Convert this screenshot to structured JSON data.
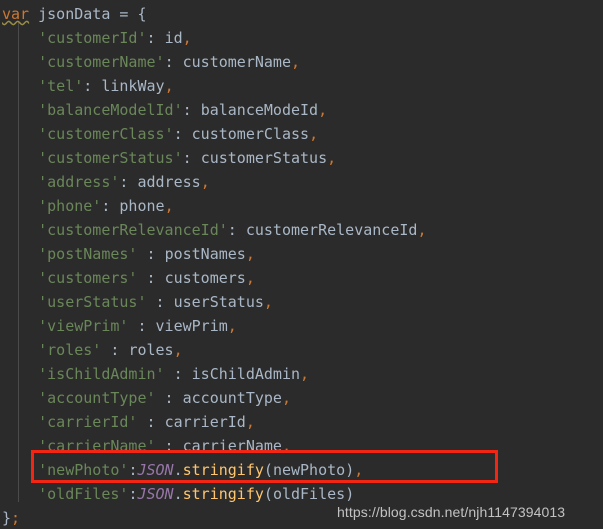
{
  "editor": {
    "background_color": "#2b2b2b",
    "default_text_color": "#a9b7c6",
    "annotation_color": "#f22613"
  },
  "code": {
    "line1": {
      "keyword": "var",
      "name": "jsonData",
      "equals": "=",
      "brace": "{"
    },
    "properties": [
      {
        "key": "'customerId'",
        "sep": ": ",
        "value": "id",
        "comma": ","
      },
      {
        "key": "'customerName'",
        "sep": ": ",
        "value": "customerName",
        "comma": ","
      },
      {
        "key": "'tel'",
        "sep": ": ",
        "value": "linkWay",
        "comma": ","
      },
      {
        "key": "'balanceModelId'",
        "sep": ": ",
        "value": "balanceModeId",
        "comma": ","
      },
      {
        "key": "'customerClass'",
        "sep": ": ",
        "value": "customerClass",
        "comma": ","
      },
      {
        "key": "'customerStatus'",
        "sep": ": ",
        "value": "customerStatus",
        "comma": ","
      },
      {
        "key": "'address'",
        "sep": ": ",
        "value": "address",
        "comma": ","
      },
      {
        "key": "'phone'",
        "sep": ": ",
        "value": "phone",
        "comma": ","
      },
      {
        "key": "'customerRelevanceId'",
        "sep": ": ",
        "value": "customerRelevanceId",
        "comma": ","
      },
      {
        "key": "'postNames'",
        "sep": " : ",
        "value": "postNames",
        "comma": ","
      },
      {
        "key": "'customers'",
        "sep": " : ",
        "value": "customers",
        "comma": ","
      },
      {
        "key": "'userStatus'",
        "sep": " : ",
        "value": "userStatus",
        "comma": ","
      },
      {
        "key": "'viewPrim'",
        "sep": " : ",
        "value": "viewPrim",
        "comma": ","
      },
      {
        "key": "'roles'",
        "sep": " : ",
        "value": "roles",
        "comma": ","
      },
      {
        "key": "'isChildAdmin'",
        "sep": " : ",
        "value": "isChildAdmin",
        "comma": ","
      },
      {
        "key": "'accountType'",
        "sep": " : ",
        "value": "accountType",
        "comma": ","
      },
      {
        "key": "'carrierId'",
        "sep": " : ",
        "value": "carrierId",
        "comma": ","
      },
      {
        "key": "'carrierName'",
        "sep": " : ",
        "value": "carrierName",
        "comma": ","
      }
    ],
    "stringify_lines": [
      {
        "key": "'newPhoto'",
        "sep": ":",
        "class_name": "JSON",
        "dot": ".",
        "method": "stringify",
        "open_paren": "(",
        "arg": "newPhoto",
        "close_paren": ")",
        "comma": ","
      },
      {
        "key": "'oldFiles'",
        "sep": ":",
        "class_name": "JSON",
        "dot": ".",
        "method": "stringify",
        "open_paren": "(",
        "arg": "oldFiles",
        "close_paren": ")",
        "comma": ""
      }
    ],
    "closing": {
      "brace": "}",
      "semicolon": ";"
    }
  },
  "annotation": {
    "name": "highlight-rectangle",
    "color": "#f22613"
  },
  "watermark": {
    "text": "https://blog.csdn.net/njh1147394013"
  }
}
